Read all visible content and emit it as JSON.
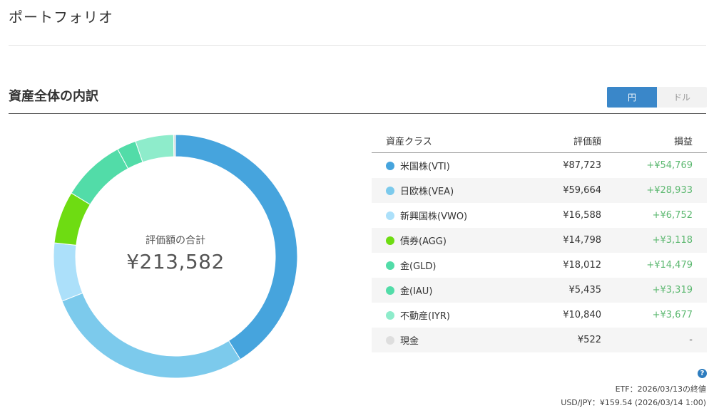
{
  "page": {
    "title": "ポートフォリオ"
  },
  "section": {
    "title": "資産全体の内訳"
  },
  "currency_toggle": {
    "yen": "円",
    "dollar": "ドル",
    "selected": "円"
  },
  "summary": {
    "label": "評価額の合計",
    "total": "¥213,582"
  },
  "table": {
    "headers": {
      "asset_class": "資産クラス",
      "value": "評価額",
      "gain": "損益"
    },
    "rows": [
      {
        "name": "米国株(VTI)",
        "color": "#46a4dd",
        "value": "¥87,723",
        "value_num": 87723,
        "gain": "+¥54,769"
      },
      {
        "name": "日欧株(VEA)",
        "color": "#7ccaec",
        "value": "¥59,664",
        "value_num": 59664,
        "gain": "+¥28,933"
      },
      {
        "name": "新興国株(VWO)",
        "color": "#ace0fa",
        "value": "¥16,588",
        "value_num": 16588,
        "gain": "+¥6,752"
      },
      {
        "name": "債券(AGG)",
        "color": "#6edc12",
        "value": "¥14,798",
        "value_num": 14798,
        "gain": "+¥3,118"
      },
      {
        "name": "金(GLD)",
        "color": "#52dca8",
        "value": "¥18,012",
        "value_num": 18012,
        "gain": "+¥14,479"
      },
      {
        "name": "金(IAU)",
        "color": "#52dca8",
        "value": "¥5,435",
        "value_num": 5435,
        "gain": "+¥3,319"
      },
      {
        "name": "不動産(IYR)",
        "color": "#8eeccb",
        "value": "¥10,840",
        "value_num": 10840,
        "gain": "+¥3,677"
      },
      {
        "name": "現金",
        "color": "#dedede",
        "value": "¥522",
        "value_num": 522,
        "gain": "-"
      }
    ]
  },
  "footnotes": {
    "help_icon": "?",
    "etf_date": "ETF：2026/03/13の終値",
    "fx_rate": "USD/JPY：¥159.54 (2026/03/14 1:00)"
  }
}
